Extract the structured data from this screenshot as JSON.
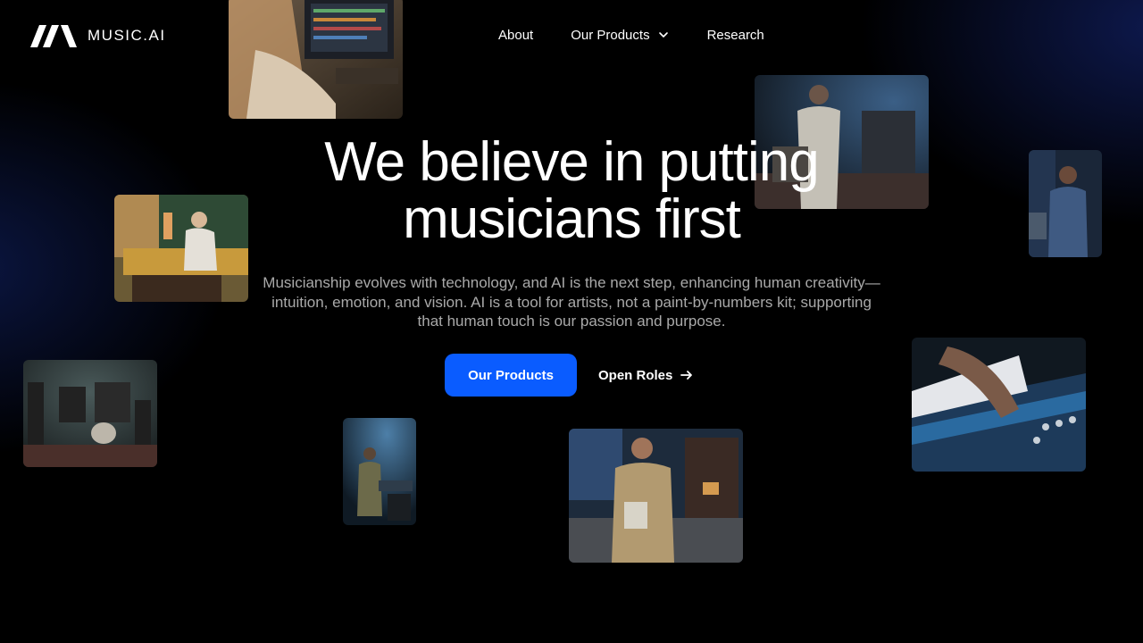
{
  "brand": {
    "name": "MUSIC.AI"
  },
  "nav": {
    "items": [
      {
        "label": "About"
      },
      {
        "label": "Our Products"
      },
      {
        "label": "Research"
      }
    ]
  },
  "hero": {
    "headline_line1": "We believe in putting",
    "headline_line2": "musicians first",
    "description": "Musicianship evolves with technology, and AI is the next step, enhancing human creativity—intuition, emotion, and vision. AI is a tool for artists, not a paint-by-numbers kit; supporting that human touch is our passion and purpose.",
    "primary_cta": "Our Products",
    "secondary_cta": "Open Roles"
  },
  "colors": {
    "background": "#000000",
    "accent": "#0a5cff",
    "text": "#ffffff",
    "muted_text": "#a9a9a9"
  },
  "icons": {
    "logo": "music-ai-logo-icon",
    "nav_dropdown": "chevron-down-icon",
    "cta_arrow": "arrow-right-icon"
  }
}
